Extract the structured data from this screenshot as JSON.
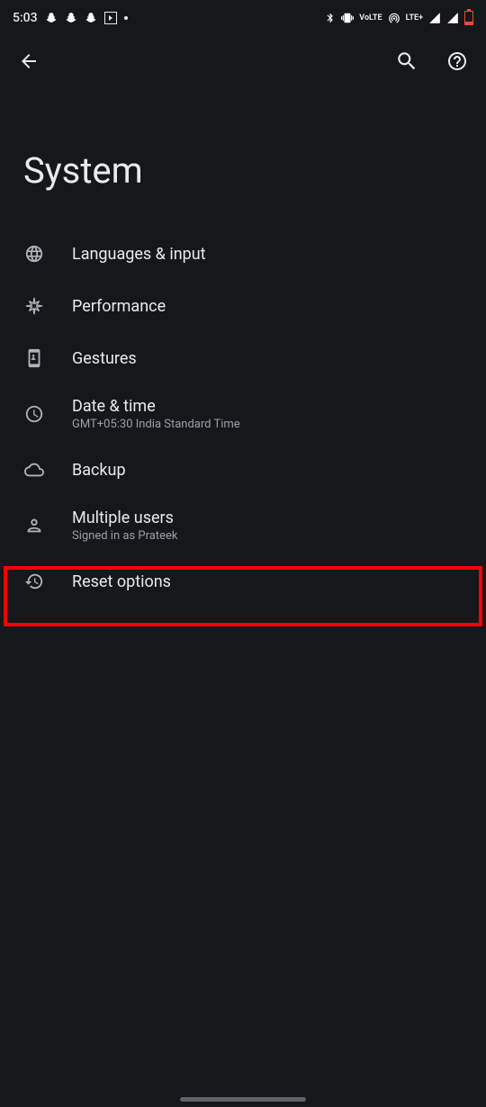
{
  "status_bar": {
    "time": "5:03",
    "lte_label": "LTE+",
    "volte_label": "VoLTE"
  },
  "app_bar": {},
  "page": {
    "title": "System"
  },
  "menu": {
    "items": [
      {
        "label": "Languages & input"
      },
      {
        "label": "Performance"
      },
      {
        "label": "Gestures"
      },
      {
        "label": "Date & time",
        "sublabel": "GMT+05:30 India Standard Time"
      },
      {
        "label": "Backup"
      },
      {
        "label": "Multiple users",
        "sublabel": "Signed in as Prateek"
      },
      {
        "label": "Reset options"
      }
    ]
  },
  "annotation": {
    "highlighted_item_index": 6
  }
}
